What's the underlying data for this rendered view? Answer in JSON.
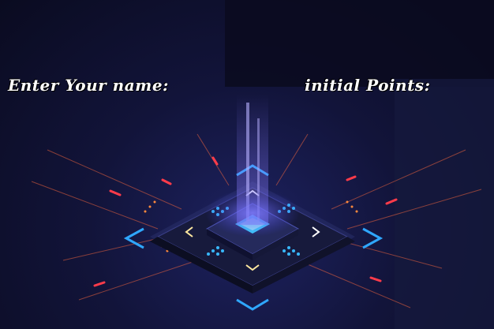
{
  "form": {
    "name_label": "Enter Your name:",
    "points_label": "initial Points:"
  },
  "colors": {
    "background": "#12143a",
    "accent_blue": "#2fa7ff",
    "accent_red": "#ff3b4a",
    "chip_glow": "#3fd4ff"
  }
}
